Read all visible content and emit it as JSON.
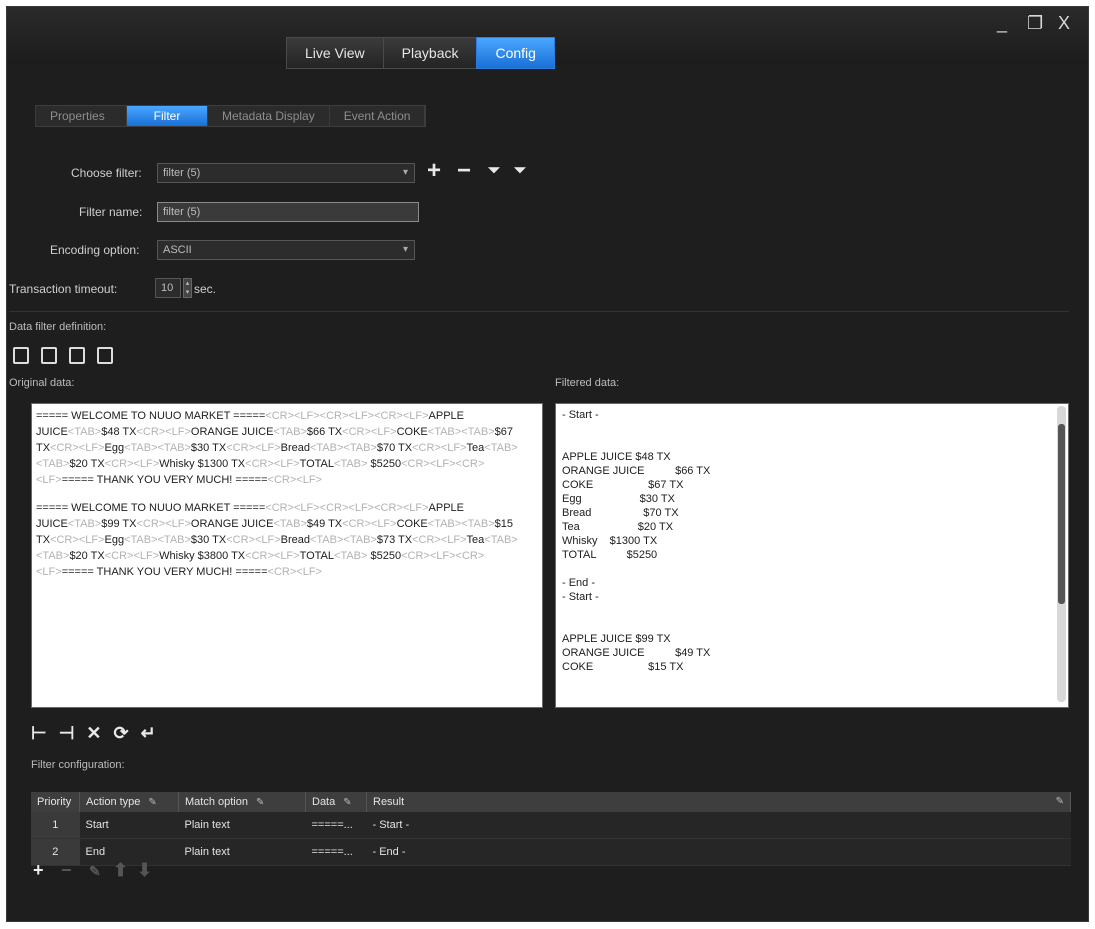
{
  "window": {
    "min": "_",
    "restore": "❐",
    "close": "X"
  },
  "main_tabs": [
    "Live View",
    "Playback",
    "Config"
  ],
  "sub_tabs": [
    "Properties",
    "Filter",
    "Metadata Display",
    "Event Action"
  ],
  "form": {
    "choose_filter_label": "Choose filter:",
    "choose_filter_value": "filter (5)",
    "filter_name_label": "Filter name:",
    "filter_name_value": "filter (5)",
    "encoding_label": "Encoding option:",
    "encoding_value": "ASCII",
    "timeout_label": "Transaction timeout:",
    "timeout_value": "10",
    "timeout_unit": "sec."
  },
  "data_filter_label": "Data filter definition:",
  "original_label": "Original data:",
  "filtered_label": "Filtered data:",
  "original_records": [
    [
      {
        "t": "===== WELCOME TO NUUO MARKET =====",
        "g": false
      },
      {
        "t": "<CR><LF><CR><LF><CR><LF>",
        "g": true
      },
      {
        "t": "APPLE JUICE",
        "g": false
      },
      {
        "t": "<TAB>",
        "g": true
      },
      {
        "t": "$48 TX",
        "g": false
      },
      {
        "t": "<CR><LF>",
        "g": true
      },
      {
        "t": "ORANGE JUICE",
        "g": false
      },
      {
        "t": "<TAB>",
        "g": true
      },
      {
        "t": "$66 TX",
        "g": false
      },
      {
        "t": "<CR><LF>",
        "g": true
      },
      {
        "t": "COKE",
        "g": false
      },
      {
        "t": "<TAB><TAB>",
        "g": true
      },
      {
        "t": "$67 TX",
        "g": false
      },
      {
        "t": "<CR><LF>",
        "g": true
      },
      {
        "t": "Egg",
        "g": false
      },
      {
        "t": "<TAB><TAB>",
        "g": true
      },
      {
        "t": "$30 TX",
        "g": false
      },
      {
        "t": "<CR><LF>",
        "g": true
      },
      {
        "t": "Bread",
        "g": false
      },
      {
        "t": "<TAB><TAB>",
        "g": true
      },
      {
        "t": "$70 TX",
        "g": false
      },
      {
        "t": "<CR><LF>",
        "g": true
      },
      {
        "t": "Tea",
        "g": false
      },
      {
        "t": "<TAB><TAB>",
        "g": true
      },
      {
        "t": "$20 TX",
        "g": false
      },
      {
        "t": "<CR><LF>",
        "g": true
      },
      {
        "t": "Whisky $1300 TX",
        "g": false
      },
      {
        "t": "<CR><LF>",
        "g": true
      },
      {
        "t": "TOTAL",
        "g": false
      },
      {
        "t": "<TAB>",
        "g": true
      },
      {
        "t": "      $5250",
        "g": false
      },
      {
        "t": "<CR><LF><CR><LF>",
        "g": true
      },
      {
        "t": "===== THANK YOU VERY MUCH! =====",
        "g": false
      },
      {
        "t": "<CR><LF>",
        "g": true
      }
    ],
    [
      {
        "t": "===== WELCOME TO NUUO MARKET =====",
        "g": false
      },
      {
        "t": "<CR><LF><CR><LF><CR><LF>",
        "g": true
      },
      {
        "t": "APPLE JUICE",
        "g": false
      },
      {
        "t": "<TAB>",
        "g": true
      },
      {
        "t": "$99 TX",
        "g": false
      },
      {
        "t": "<CR><LF>",
        "g": true
      },
      {
        "t": "ORANGE JUICE",
        "g": false
      },
      {
        "t": "<TAB>",
        "g": true
      },
      {
        "t": "$49 TX",
        "g": false
      },
      {
        "t": "<CR><LF>",
        "g": true
      },
      {
        "t": "COKE",
        "g": false
      },
      {
        "t": "<TAB><TAB>",
        "g": true
      },
      {
        "t": "$15 TX",
        "g": false
      },
      {
        "t": "<CR><LF>",
        "g": true
      },
      {
        "t": "Egg",
        "g": false
      },
      {
        "t": "<TAB><TAB>",
        "g": true
      },
      {
        "t": "$30 TX",
        "g": false
      },
      {
        "t": "<CR><LF>",
        "g": true
      },
      {
        "t": "Bread",
        "g": false
      },
      {
        "t": "<TAB><TAB>",
        "g": true
      },
      {
        "t": "$73 TX",
        "g": false
      },
      {
        "t": "<CR><LF>",
        "g": true
      },
      {
        "t": "Tea",
        "g": false
      },
      {
        "t": "<TAB><TAB>",
        "g": true
      },
      {
        "t": "$20 TX",
        "g": false
      },
      {
        "t": "<CR><LF>",
        "g": true
      },
      {
        "t": "Whisky $3800 TX",
        "g": false
      },
      {
        "t": "<CR><LF>",
        "g": true
      },
      {
        "t": "TOTAL",
        "g": false
      },
      {
        "t": "<TAB>",
        "g": true
      },
      {
        "t": "      $5250",
        "g": false
      },
      {
        "t": "<CR><LF><CR><LF>",
        "g": true
      },
      {
        "t": "===== THANK YOU VERY MUCH! =====",
        "g": false
      },
      {
        "t": "<CR><LF>",
        "g": true
      }
    ]
  ],
  "filtered_text": "- Start -\n\n\nAPPLE JUICE $48 TX\nORANGE JUICE          $66 TX\nCOKE                  $67 TX\nEgg                   $30 TX\nBread                 $70 TX\nTea                   $20 TX\nWhisky    $1300 TX\nTOTAL          $5250\n\n- End -\n- Start -\n\n\nAPPLE JUICE $99 TX\nORANGE JUICE          $49 TX\nCOKE                  $15 TX",
  "filter_config_label": "Filter configuration:",
  "table": {
    "headers": [
      "Priority",
      "Action type",
      "Match option",
      "Data",
      "Result"
    ],
    "rows": [
      {
        "priority": "1",
        "action": "Start",
        "match": "Plain text",
        "data": "=====...",
        "result": "- Start -"
      },
      {
        "priority": "2",
        "action": "End",
        "match": "Plain text",
        "data": "=====...",
        "result": "- End -"
      }
    ]
  },
  "colors": {
    "accent": "#1a6fd6",
    "background": "#1e1e1e",
    "panel": "#ffffff"
  }
}
